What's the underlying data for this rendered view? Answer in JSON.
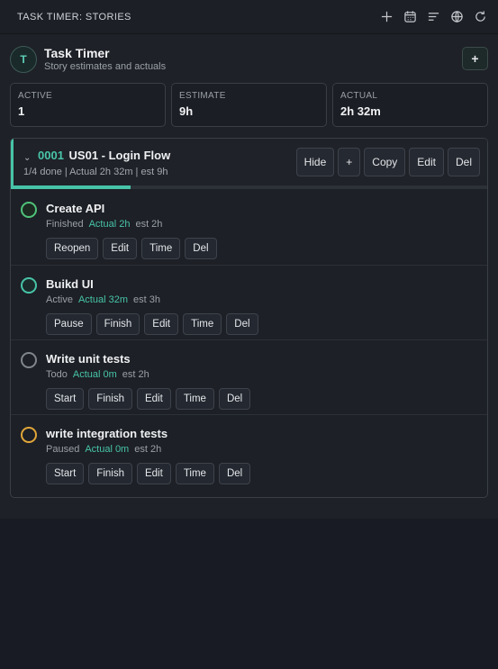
{
  "titlebar": {
    "title": "TASK TIMER: STORIES",
    "icons": [
      "plus-icon",
      "calendar-icon",
      "list-icon",
      "globe-icon",
      "refresh-icon"
    ]
  },
  "header": {
    "avatar": "T",
    "title": "Task Timer",
    "subtitle": "Story estimates and actuals",
    "add_label": "+"
  },
  "stats": [
    {
      "label": "ACTIVE",
      "value": "1"
    },
    {
      "label": "ESTIMATE",
      "value": "9h"
    },
    {
      "label": "ACTUAL",
      "value": "2h 32m"
    }
  ],
  "story": {
    "chevron": "⌄",
    "id": "0001",
    "name": "US01 - Login Flow",
    "meta": "1/4 done | Actual 2h 32m | est 9h",
    "progress_percent": 25,
    "actions": [
      "Hide",
      "+",
      "Copy",
      "Edit",
      "Del"
    ],
    "tasks": [
      {
        "name": "Create API",
        "status": "Finished",
        "actual": "Actual 2h",
        "estimate": "est 2h",
        "status_color": "#4fc27a",
        "fill": "#1d2a22",
        "buttons": [
          "Reopen",
          "Edit",
          "Time",
          "Del"
        ]
      },
      {
        "name": "Buikd UI",
        "status": "Active",
        "actual": "Actual 32m",
        "estimate": "est 3h",
        "status_color": "#47c4a8",
        "fill": "#1b2a2a",
        "buttons": [
          "Pause",
          "Finish",
          "Edit",
          "Time",
          "Del"
        ]
      },
      {
        "name": "Write unit tests",
        "status": "Todo",
        "actual": "Actual 0m",
        "estimate": "est 2h",
        "status_color": "#80858c",
        "fill": "transparent",
        "buttons": [
          "Start",
          "Finish",
          "Edit",
          "Time",
          "Del"
        ]
      },
      {
        "name": "write integration tests",
        "status": "Paused",
        "actual": "Actual 0m",
        "estimate": "est 2h",
        "status_color": "#e2a63a",
        "fill": "transparent",
        "buttons": [
          "Start",
          "Finish",
          "Edit",
          "Time",
          "Del"
        ]
      }
    ]
  }
}
